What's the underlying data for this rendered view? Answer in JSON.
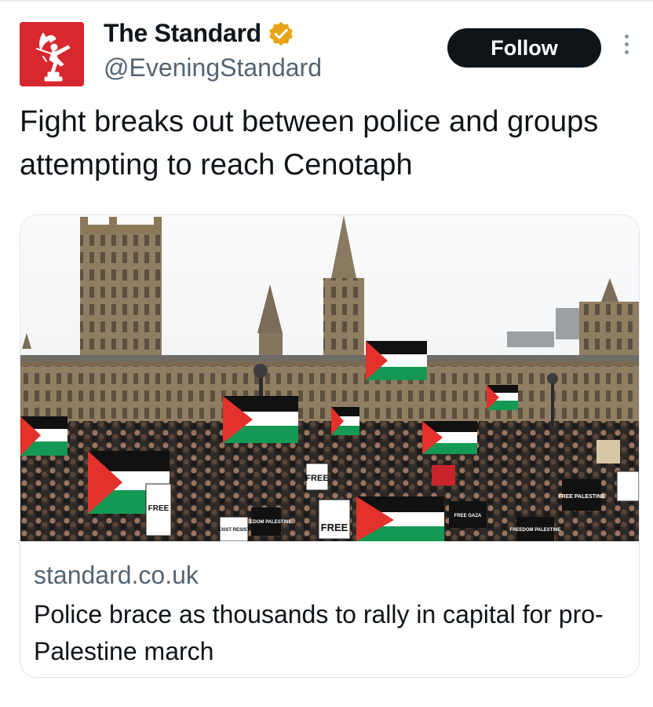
{
  "account": {
    "display_name": "The Standard",
    "handle": "@EveningStandard",
    "verified_badge_color": "#e8a317",
    "avatar_color": "#d7282f",
    "avatar_icon": "eros-statue-logo"
  },
  "actions": {
    "follow_label": "Follow",
    "more_icon": "more-vertical-icon"
  },
  "tweet": {
    "text": "Fight breaks out between police and groups attempting to reach Cenotaph"
  },
  "link_card": {
    "image_subject": "pro-palestine-march-westminster-photo",
    "domain": "standard.co.uk",
    "title": "Police brace as thousands to rally in capital for pro-Palestine march",
    "signs": [
      "FREE",
      "FREE PALESTINE",
      "FREEDOM PALESTINE",
      "FREE GAZA",
      "EXIST RESIST"
    ]
  },
  "colors": {
    "follow_bg": "#0f1419",
    "handle_gray": "#536471",
    "flag_green": "#149954",
    "flag_red": "#e4312b",
    "flag_black": "#111111"
  }
}
